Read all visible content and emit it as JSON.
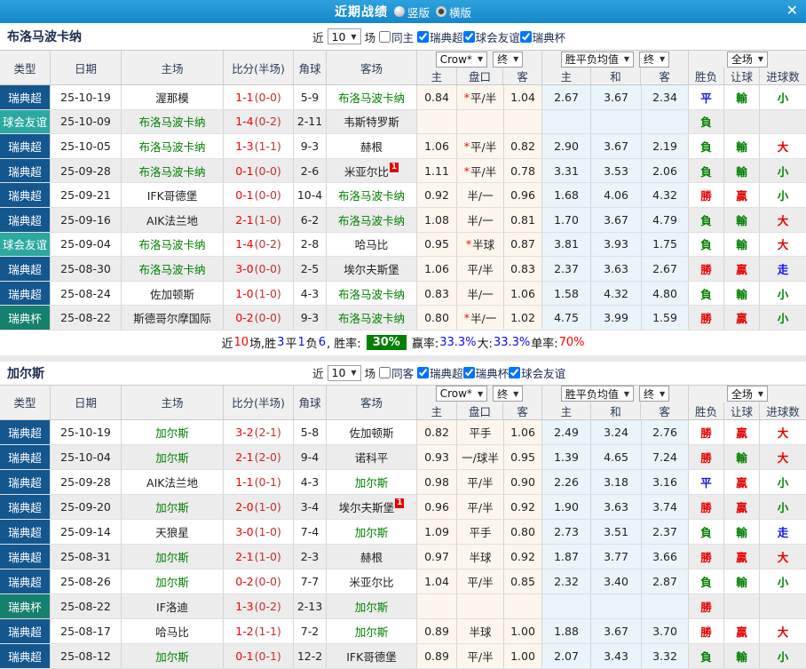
{
  "titlebar": {
    "title": "近期战绩",
    "vertical_label": "竖版",
    "horizontal_label": "横版",
    "selected_layout": "横版",
    "close_label": "✕"
  },
  "columns": {
    "type": "类型",
    "date": "日期",
    "home": "主场",
    "score": "比分(半场)",
    "corner": "角球",
    "away": "客场",
    "odds_home": "主",
    "odds_handicap": "盘口",
    "odds_away": "客",
    "avg_home": "主",
    "avg_draw": "和",
    "avg_away": "客",
    "result_wdl": "胜负",
    "result_handicap": "让球",
    "result_goals": "进球数"
  },
  "dropdowns": {
    "company": "Crow*",
    "final": "终",
    "avg": "胜平负均值",
    "scope": "全场"
  },
  "colors": {
    "topbar": "#1b96d5",
    "league_blue": "#14578f",
    "friendly_teal": "#2ba8a0",
    "cup_green": "#15806d",
    "team_green": "#008000",
    "score_red": "#f20000",
    "win_red": "#e60000",
    "draw_blue": "#1414e6",
    "lose_green": "#008000",
    "rate_badge_green": "#008000",
    "odds_bg": "#fdf6ec",
    "avg_bg": "#e9f4fb"
  },
  "sections": [
    {
      "team": "布洛马波卡纳",
      "filters": {
        "near_label": "近",
        "count": "10",
        "games_label": "场",
        "same_label": "同主",
        "same_checked": false,
        "leagues": [
          {
            "label": "瑞典超",
            "checked": true
          },
          {
            "label": "球会友谊",
            "checked": true
          },
          {
            "label": "瑞典杯",
            "checked": true
          }
        ]
      },
      "rows": [
        {
          "type": "瑞典超",
          "style": "league",
          "date": "25-10-19",
          "home": "渥那模",
          "hg": false,
          "score": "1-1",
          "half": "(0-0)",
          "corner": "5-9",
          "away": "布洛马波卡纳",
          "ag": true,
          "o1": "0.84",
          "star": true,
          "hc": "平/半",
          "o2": "1.04",
          "a1": "2.67",
          "a2": "3.67",
          "a3": "2.34",
          "r1": "平",
          "r1c": "b",
          "r2": "輸",
          "r2c": "g",
          "r3": "小",
          "r3c": "g"
        },
        {
          "type": "球会友谊",
          "style": "friendly",
          "date": "25-10-09",
          "home": "布洛马波卡纳",
          "hg": true,
          "score": "1-4",
          "half": "(0-2)",
          "corner": "2-11",
          "away": "韦斯特罗斯",
          "ag": false,
          "o1": "",
          "star": false,
          "hc": "",
          "o2": "",
          "a1": "",
          "a2": "",
          "a3": "",
          "r1": "負",
          "r1c": "g",
          "r2": "",
          "r2c": "",
          "r3": "",
          "r3c": ""
        },
        {
          "type": "瑞典超",
          "style": "league",
          "date": "25-10-05",
          "home": "布洛马波卡纳",
          "hg": true,
          "score": "1-3",
          "half": "(1-1)",
          "corner": "9-3",
          "away": "赫根",
          "ag": false,
          "o1": "1.06",
          "star": true,
          "hc": "平/半",
          "o2": "0.82",
          "a1": "2.90",
          "a2": "3.67",
          "a3": "2.19",
          "r1": "負",
          "r1c": "g",
          "r2": "輸",
          "r2c": "g",
          "r3": "大",
          "r3c": "r"
        },
        {
          "type": "瑞典超",
          "style": "league",
          "date": "25-09-28",
          "home": "布洛马波卡纳",
          "hg": true,
          "score": "0-1",
          "half": "(0-0)",
          "corner": "2-6",
          "away": "米亚尔比",
          "ag": false,
          "arc": true,
          "o1": "1.11",
          "star": true,
          "hc": "平/半",
          "o2": "0.78",
          "a1": "3.31",
          "a2": "3.53",
          "a3": "2.06",
          "r1": "負",
          "r1c": "g",
          "r2": "輸",
          "r2c": "g",
          "r3": "小",
          "r3c": "g"
        },
        {
          "type": "瑞典超",
          "style": "league",
          "date": "25-09-21",
          "home": "IFK哥德堡",
          "hg": false,
          "score": "0-1",
          "half": "(0-0)",
          "corner": "10-4",
          "away": "布洛马波卡纳",
          "ag": true,
          "o1": "0.92",
          "star": false,
          "hc": "半/一",
          "o2": "0.96",
          "a1": "1.68",
          "a2": "4.06",
          "a3": "4.32",
          "r1": "勝",
          "r1c": "r",
          "r2": "贏",
          "r2c": "r",
          "r3": "小",
          "r3c": "g"
        },
        {
          "type": "瑞典超",
          "style": "league",
          "date": "25-09-16",
          "home": "AIK法兰地",
          "hg": false,
          "score": "2-1",
          "half": "(1-0)",
          "corner": "6-2",
          "away": "布洛马波卡纳",
          "ag": true,
          "o1": "1.08",
          "star": false,
          "hc": "半/一",
          "o2": "0.81",
          "a1": "1.70",
          "a2": "3.67",
          "a3": "4.79",
          "r1": "負",
          "r1c": "g",
          "r2": "輸",
          "r2c": "g",
          "r3": "大",
          "r3c": "r"
        },
        {
          "type": "球会友谊",
          "style": "friendly",
          "date": "25-09-04",
          "home": "布洛马波卡纳",
          "hg": true,
          "score": "1-4",
          "half": "(0-2)",
          "corner": "2-8",
          "away": "哈马比",
          "ag": false,
          "o1": "0.95",
          "star": true,
          "hc": "半球",
          "o2": "0.87",
          "a1": "3.81",
          "a2": "3.93",
          "a3": "1.75",
          "r1": "負",
          "r1c": "g",
          "r2": "輸",
          "r2c": "g",
          "r3": "大",
          "r3c": "r"
        },
        {
          "type": "瑞典超",
          "style": "league",
          "date": "25-08-30",
          "home": "布洛马波卡纳",
          "hg": true,
          "score": "3-0",
          "half": "(0-0)",
          "corner": "2-5",
          "away": "埃尔夫斯堡",
          "ag": false,
          "o1": "1.06",
          "star": false,
          "hc": "平/半",
          "o2": "0.83",
          "a1": "2.37",
          "a2": "3.63",
          "a3": "2.67",
          "r1": "勝",
          "r1c": "r",
          "r2": "贏",
          "r2c": "r",
          "r3": "走",
          "r3c": "b"
        },
        {
          "type": "瑞典超",
          "style": "league",
          "date": "25-08-24",
          "home": "佐加顿斯",
          "hg": false,
          "score": "1-0",
          "half": "(1-0)",
          "corner": "4-3",
          "away": "布洛马波卡纳",
          "ag": true,
          "o1": "0.83",
          "star": false,
          "hc": "半/一",
          "o2": "1.06",
          "a1": "1.58",
          "a2": "4.32",
          "a3": "4.80",
          "r1": "負",
          "r1c": "g",
          "r2": "輸",
          "r2c": "g",
          "r3": "小",
          "r3c": "g"
        },
        {
          "type": "瑞典杯",
          "style": "cup",
          "date": "25-08-22",
          "home": "斯德哥尔摩国际",
          "hg": false,
          "score": "0-2",
          "half": "(0-0)",
          "corner": "9-3",
          "away": "布洛马波卡纳",
          "ag": true,
          "o1": "0.80",
          "star": true,
          "hc": "半/一",
          "o2": "1.02",
          "a1": "4.75",
          "a2": "3.99",
          "a3": "1.59",
          "r1": "勝",
          "r1c": "r",
          "r2": "贏",
          "r2c": "r",
          "r3": "小",
          "r3c": "g"
        }
      ],
      "summary_parts": [
        {
          "t": "近",
          "c": "k"
        },
        {
          "t": "10",
          "c": "r"
        },
        {
          "t": "场,胜",
          "c": "k"
        },
        {
          "t": "3",
          "c": "b"
        },
        {
          "t": "平",
          "c": "k"
        },
        {
          "t": "1",
          "c": "b"
        },
        {
          "t": "负",
          "c": "k"
        },
        {
          "t": "6",
          "c": "b"
        },
        {
          "t": ", 胜率:",
          "c": "k"
        },
        {
          "t": "30%",
          "c": "badge"
        },
        {
          "t": "赢率:",
          "c": "k"
        },
        {
          "t": "33.3%",
          "c": "b"
        },
        {
          "t": " 大:",
          "c": "k"
        },
        {
          "t": "33.3%",
          "c": "b"
        },
        {
          "t": " 单率:",
          "c": "k"
        },
        {
          "t": "70%",
          "c": "r"
        }
      ]
    },
    {
      "team": "加尔斯",
      "filters": {
        "near_label": "近",
        "count": "10",
        "games_label": "场",
        "same_label": "同客",
        "same_checked": false,
        "leagues": [
          {
            "label": "瑞典超",
            "checked": true
          },
          {
            "label": "瑞典杯",
            "checked": true
          },
          {
            "label": "球会友谊",
            "checked": true
          }
        ]
      },
      "rows": [
        {
          "type": "瑞典超",
          "style": "league",
          "date": "25-10-19",
          "home": "加尔斯",
          "hg": true,
          "score": "3-2",
          "half": "(2-1)",
          "corner": "5-8",
          "away": "佐加顿斯",
          "ag": false,
          "o1": "0.82",
          "star": false,
          "hc": "平手",
          "o2": "1.06",
          "a1": "2.49",
          "a2": "3.24",
          "a3": "2.76",
          "r1": "勝",
          "r1c": "r",
          "r2": "贏",
          "r2c": "r",
          "r3": "大",
          "r3c": "r"
        },
        {
          "type": "瑞典超",
          "style": "league",
          "date": "25-10-04",
          "home": "加尔斯",
          "hg": true,
          "score": "2-1",
          "half": "(2-0)",
          "corner": "9-4",
          "away": "诺科平",
          "ag": false,
          "o1": "0.93",
          "star": false,
          "hc": "一/球半",
          "o2": "0.95",
          "a1": "1.39",
          "a2": "4.65",
          "a3": "7.24",
          "r1": "勝",
          "r1c": "r",
          "r2": "輸",
          "r2c": "g",
          "r3": "大",
          "r3c": "r"
        },
        {
          "type": "瑞典超",
          "style": "league",
          "date": "25-09-28",
          "home": "AIK法兰地",
          "hg": false,
          "score": "1-1",
          "half": "(0-1)",
          "corner": "4-3",
          "away": "加尔斯",
          "ag": true,
          "o1": "0.98",
          "star": false,
          "hc": "平/半",
          "o2": "0.90",
          "a1": "2.26",
          "a2": "3.18",
          "a3": "3.16",
          "r1": "平",
          "r1c": "b",
          "r2": "贏",
          "r2c": "r",
          "r3": "小",
          "r3c": "g"
        },
        {
          "type": "瑞典超",
          "style": "league",
          "date": "25-09-20",
          "home": "加尔斯",
          "hg": true,
          "score": "2-0",
          "half": "(1-0)",
          "corner": "3-4",
          "away": "埃尔夫斯堡",
          "ag": false,
          "arc": true,
          "o1": "0.96",
          "star": false,
          "hc": "平/半",
          "o2": "0.92",
          "a1": "1.90",
          "a2": "3.63",
          "a3": "3.74",
          "r1": "勝",
          "r1c": "r",
          "r2": "贏",
          "r2c": "r",
          "r3": "小",
          "r3c": "g"
        },
        {
          "type": "瑞典超",
          "style": "league",
          "date": "25-09-14",
          "home": "天狼星",
          "hg": false,
          "score": "3-0",
          "half": "(1-0)",
          "corner": "7-4",
          "away": "加尔斯",
          "ag": true,
          "o1": "1.09",
          "star": false,
          "hc": "平手",
          "o2": "0.80",
          "a1": "2.73",
          "a2": "3.51",
          "a3": "2.37",
          "r1": "負",
          "r1c": "g",
          "r2": "輸",
          "r2c": "g",
          "r3": "走",
          "r3c": "b"
        },
        {
          "type": "瑞典超",
          "style": "league",
          "date": "25-08-31",
          "home": "加尔斯",
          "hg": true,
          "score": "2-1",
          "half": "(1-0)",
          "corner": "2-3",
          "away": "赫根",
          "ag": false,
          "o1": "0.97",
          "star": false,
          "hc": "半球",
          "o2": "0.92",
          "a1": "1.87",
          "a2": "3.77",
          "a3": "3.66",
          "r1": "勝",
          "r1c": "r",
          "r2": "贏",
          "r2c": "r",
          "r3": "大",
          "r3c": "r"
        },
        {
          "type": "瑞典超",
          "style": "league",
          "date": "25-08-26",
          "home": "加尔斯",
          "hg": true,
          "score": "0-2",
          "half": "(0-0)",
          "corner": "7-7",
          "away": "米亚尔比",
          "ag": false,
          "o1": "1.04",
          "star": false,
          "hc": "平/半",
          "o2": "0.85",
          "a1": "2.32",
          "a2": "3.40",
          "a3": "2.87",
          "r1": "負",
          "r1c": "g",
          "r2": "輸",
          "r2c": "g",
          "r3": "小",
          "r3c": "g"
        },
        {
          "type": "瑞典杯",
          "style": "cup",
          "date": "25-08-22",
          "home": "IF洛迪",
          "hg": false,
          "score": "1-3",
          "half": "(0-2)",
          "corner": "2-13",
          "away": "加尔斯",
          "ag": true,
          "o1": "",
          "star": false,
          "hc": "",
          "o2": "",
          "a1": "",
          "a2": "",
          "a3": "",
          "r1": "勝",
          "r1c": "r",
          "r2": "",
          "r2c": "",
          "r3": "",
          "r3c": ""
        },
        {
          "type": "瑞典超",
          "style": "league",
          "date": "25-08-17",
          "home": "哈马比",
          "hg": false,
          "score": "1-2",
          "half": "(1-1)",
          "corner": "7-2",
          "away": "加尔斯",
          "ag": true,
          "o1": "0.89",
          "star": false,
          "hc": "半球",
          "o2": "1.00",
          "a1": "1.88",
          "a2": "3.67",
          "a3": "3.70",
          "r1": "勝",
          "r1c": "r",
          "r2": "贏",
          "r2c": "r",
          "r3": "大",
          "r3c": "r"
        },
        {
          "type": "瑞典超",
          "style": "league",
          "date": "25-08-12",
          "home": "加尔斯",
          "hg": true,
          "score": "0-1",
          "half": "(0-1)",
          "corner": "12-2",
          "away": "IFK哥德堡",
          "ag": false,
          "o1": "0.89",
          "star": false,
          "hc": "平/半",
          "o2": "1.00",
          "a1": "2.07",
          "a2": "3.43",
          "a3": "3.32",
          "r1": "負",
          "r1c": "g",
          "r2": "輸",
          "r2c": "g",
          "r3": "小",
          "r3c": "g"
        }
      ]
    }
  ]
}
